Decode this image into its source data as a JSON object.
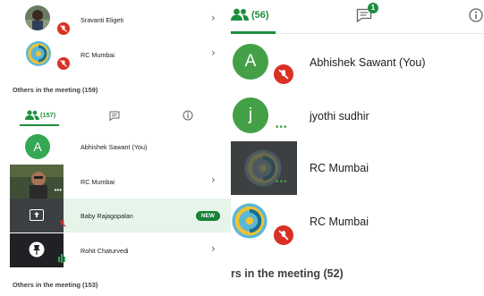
{
  "left_panel": {
    "top_participants": [
      {
        "name": "Sravanti Eligeti",
        "muted": true
      },
      {
        "name": "RC Mumbai",
        "muted": true
      }
    ],
    "others_label_top": "Others in the meeting (159)",
    "tabs": {
      "people_count": "(157)"
    },
    "participants": [
      {
        "name": "Abhishek Sawant (You)",
        "avatar_letter": "A",
        "avatar_color": "#34a853"
      },
      {
        "name": "RC Mumbai"
      },
      {
        "name": "Baby Rajagopalan",
        "badge": "NEW"
      },
      {
        "name": "Rohit Chaturvedi"
      }
    ],
    "others_label_bottom": "Others in the meeting (153)"
  },
  "right_panel": {
    "tabs": {
      "people_count": "(56)",
      "chat_unread": "1"
    },
    "participants": [
      {
        "name": "Abhishek Sawant (You)",
        "avatar_letter": "A",
        "avatar_color": "#43a047",
        "muted": true
      },
      {
        "name": "jyothi sudhir",
        "avatar_letter": "j",
        "avatar_color": "#43a047"
      },
      {
        "name": "RC Mumbai"
      },
      {
        "name": "RC Mumbai",
        "muted": true
      }
    ],
    "others_label": "rs in the meeting (52)"
  },
  "colors": {
    "accent": "#1e8e3e",
    "muted_red": "#d93025",
    "badge_green": "#188038"
  }
}
